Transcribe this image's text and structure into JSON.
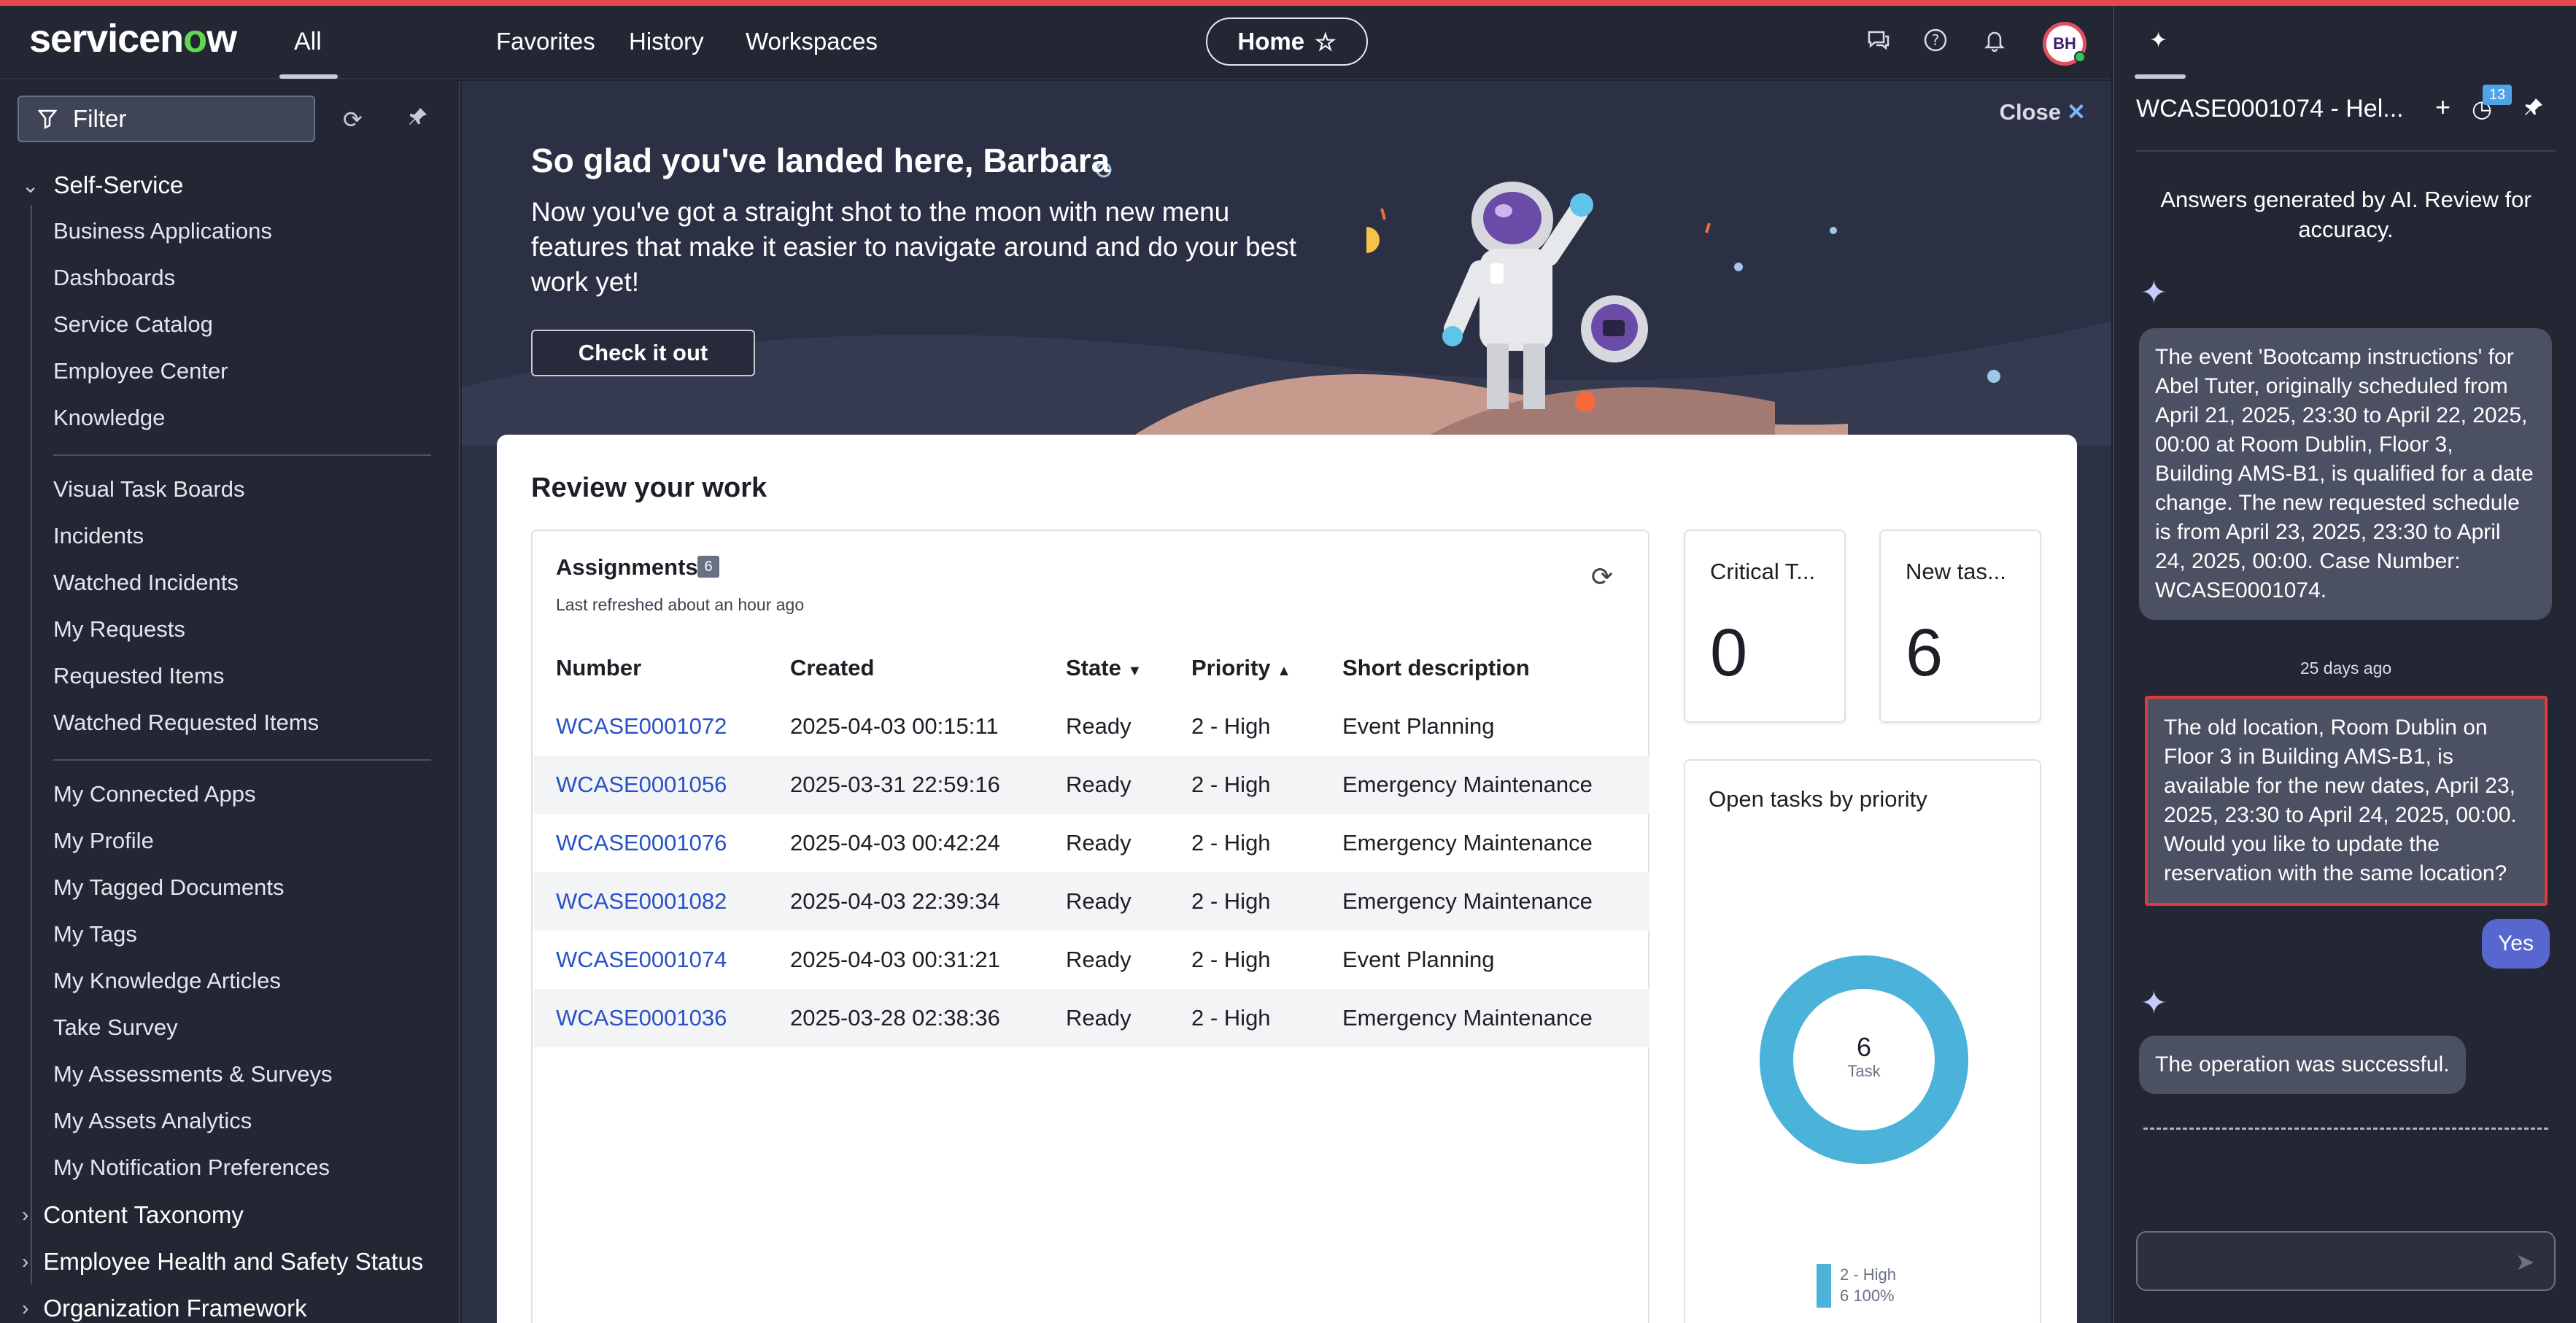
{
  "header": {
    "logo": "servicenow",
    "all_label": "All",
    "nav": [
      "Favorites",
      "History",
      "Workspaces"
    ],
    "home_label": "Home",
    "avatar_initials": "BH"
  },
  "sidebar": {
    "filter_placeholder": "Filter",
    "group_open": "Self-Service",
    "items_a": [
      "Business Applications",
      "Dashboards",
      "Service Catalog",
      "Employee Center",
      "Knowledge"
    ],
    "items_b": [
      "Visual Task Boards",
      "Incidents",
      "Watched Incidents",
      "My Requests",
      "Requested Items",
      "Watched Requested Items"
    ],
    "items_c": [
      "My Connected Apps",
      "My Profile",
      "My Tagged Documents",
      "My Tags",
      "My Knowledge Articles",
      "Take Survey",
      "My Assessments & Surveys",
      "My Assets Analytics",
      "My Notification Preferences"
    ],
    "groups_closed": [
      "Content Taxonomy",
      "Employee Health and Safety Status",
      "Organization Framework"
    ]
  },
  "banner": {
    "title": "So glad you've landed here, Barbara",
    "subtitle": "Now you've got a straight shot to the moon with new menu features that make it easier to navigate around and do your best work yet!",
    "button": "Check it out",
    "close": "Close"
  },
  "review": {
    "title": "Review your work",
    "assignments": {
      "title": "Assignments",
      "count": "6",
      "refreshed": "Last refreshed about an hour ago",
      "columns": [
        "Number",
        "Created",
        "State",
        "Priority",
        "Short description"
      ],
      "rows": [
        [
          "WCASE0001072",
          "2025-04-03 00:15:11",
          "Ready",
          "2 - High",
          "Event Planning"
        ],
        [
          "WCASE0001056",
          "2025-03-31 22:59:16",
          "Ready",
          "2 - High",
          "Emergency Maintenance"
        ],
        [
          "WCASE0001076",
          "2025-04-03 00:42:24",
          "Ready",
          "2 - High",
          "Emergency Maintenance"
        ],
        [
          "WCASE0001082",
          "2025-04-03 22:39:34",
          "Ready",
          "2 - High",
          "Emergency Maintenance"
        ],
        [
          "WCASE0001074",
          "2025-04-03 00:31:21",
          "Ready",
          "2 - High",
          "Event Planning"
        ],
        [
          "WCASE0001036",
          "2025-03-28 02:38:36",
          "Ready",
          "2 - High",
          "Emergency Maintenance"
        ]
      ]
    },
    "metrics": [
      {
        "label": "Critical T...",
        "value": "0"
      },
      {
        "label": "New tas...",
        "value": "6"
      }
    ],
    "donut": {
      "title": "Open tasks by priority",
      "center_value": "6",
      "center_label": "Task",
      "legend_label": "2 - High",
      "legend_value": "6 100%",
      "color": "#4bb3d9"
    }
  },
  "assistant": {
    "title": "WCASE0001074 - Hel...",
    "badge": "13",
    "disclaimer": "Answers generated by AI. Review for accuracy.",
    "msg1": "The event 'Bootcamp instructions' for Abel Tuter, originally scheduled from April 21, 2025, 23:30 to April 22, 2025, 00:00 at Room Dublin, Floor 3, Building AMS-B1, is qualified for a date change. The new requested schedule is from April 23, 2025, 23:30 to April 24, 2025, 00:00. Case Number: WCASE0001074.",
    "time_ago": "25 days ago",
    "msg2": "The old location, Room Dublin on Floor 3 in Building AMS-B1, is available for the new dates, April 23, 2025, 23:30 to April 24, 2025, 00:00. Would you like to update the reservation with the same location?",
    "user_reply": "Yes",
    "msg3": "The operation was successful.",
    "input_value": ""
  }
}
